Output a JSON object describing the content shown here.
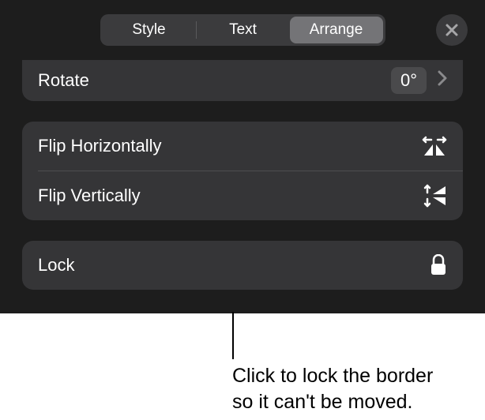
{
  "header": {
    "tabs": {
      "style": "Style",
      "text": "Text",
      "arrange": "Arrange"
    }
  },
  "rotate": {
    "label": "Rotate",
    "value": "0°"
  },
  "flip": {
    "horizontal": "Flip Horizontally",
    "vertical": "Flip Vertically"
  },
  "lock": {
    "label": "Lock"
  },
  "callout": {
    "line1": "Click to lock the border",
    "line2": "so it can't be moved."
  }
}
